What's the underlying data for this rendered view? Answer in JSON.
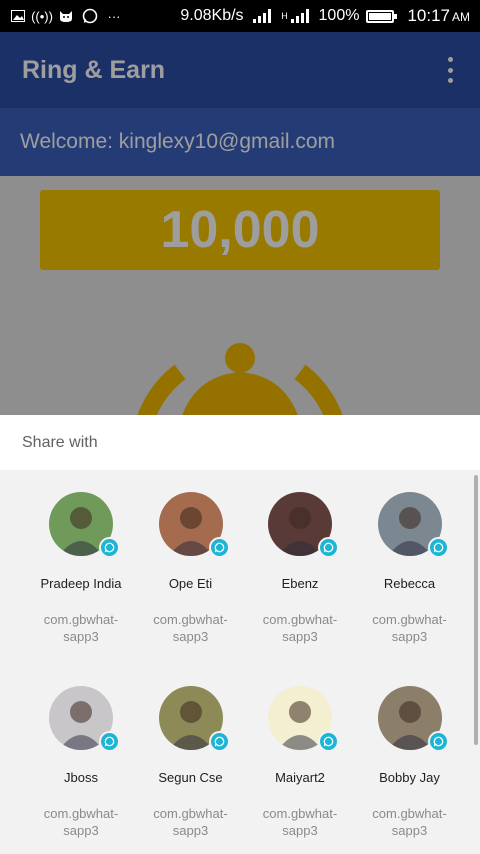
{
  "status_bar": {
    "network_speed": "9.08Kb/s",
    "signal_1": "▂▄▆█",
    "signal_2_labels": "H",
    "signal_2": "▂▄▆█",
    "battery_text": "100%",
    "battery_level": 1.0,
    "time": "10:17",
    "ampm": "AM"
  },
  "app": {
    "title": "Ring & Earn",
    "welcome": "Welcome: kinglexy10@gmail.com",
    "points": "10,000"
  },
  "share_sheet": {
    "title": "Share with",
    "items": [
      {
        "name": "Pradeep India",
        "package": "com.gbwhat-sapp3",
        "avatar_color": "#6f9a5a"
      },
      {
        "name": "Ope Eti",
        "package": "com.gbwhat-sapp3",
        "avatar_color": "#a56b4f"
      },
      {
        "name": "Ebenz",
        "package": "com.gbwhat-sapp3",
        "avatar_color": "#5a3a36"
      },
      {
        "name": "Rebecca",
        "package": "com.gbwhat-sapp3",
        "avatar_color": "#7b8791"
      },
      {
        "name": "Jboss",
        "package": "com.gbwhat-sapp3",
        "avatar_color": "#c9c6c9"
      },
      {
        "name": "Segun Cse",
        "package": "com.gbwhat-sapp3",
        "avatar_color": "#8e8a58"
      },
      {
        "name": "Maiyart2",
        "package": "com.gbwhat-sapp3",
        "avatar_color": "#f3efd0"
      },
      {
        "name": "Bobby Jay",
        "package": "com.gbwhat-sapp3",
        "avatar_color": "#8b7f6a"
      }
    ]
  },
  "colors": {
    "accent_teal": "#1cb5d6",
    "app_bar_blue": "#2e4ea8",
    "points_gold": "#f6c500"
  }
}
